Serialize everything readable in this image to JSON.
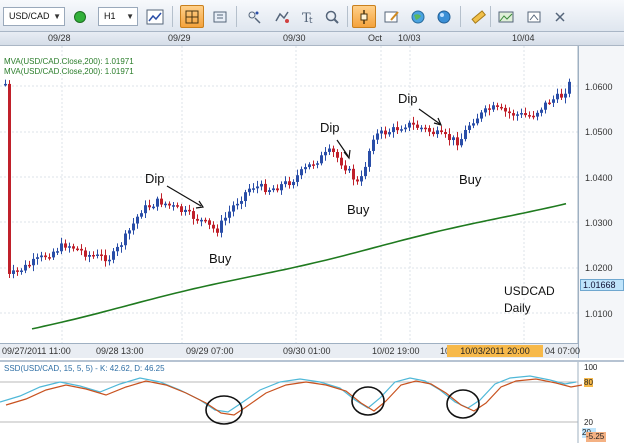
{
  "toolbar": {
    "symbol": "USD/CAD",
    "period": "H1",
    "icons": [
      "status-dot-icon",
      "chart-type-icon",
      "crosshair-icon",
      "zoom-icon",
      "indicator-icon",
      "objects-icon",
      "text-icon",
      "magnify-icon",
      "cursor-icon",
      "pencil-icon",
      "globe-icon",
      "ruler-icon",
      "screenshot-icon",
      "settings-icon",
      "close-icon"
    ]
  },
  "date_header": [
    "09/28",
    "09/29",
    "09/30",
    "Oct",
    "10/03",
    "10/04"
  ],
  "legend": {
    "ma_line1": "MVA(USD/CAD.Close,200): 1.01971",
    "ma_line2": "MVA(USD/CAD.Close,200): 1.01971"
  },
  "annotations": {
    "dip1": "Dip",
    "buy1": "Buy",
    "dip2": "Dip",
    "buy2": "Buy",
    "dip3": "Dip",
    "buy3": "Buy"
  },
  "symbol_text": {
    "line1": "USDCAD",
    "line2": "Daily"
  },
  "price_axis": [
    "1.0600",
    "1.0500",
    "1.0400",
    "1.0300",
    "1.0200",
    "1.0100"
  ],
  "current_price": "1.01668",
  "time_axis": [
    "09/27/2011 11:00",
    "09/28 13:00",
    "09/29 07:00",
    "09/30 01:00",
    "10/02 19:00",
    "10/0",
    "04 07:00"
  ],
  "time_axis_highlight": "10/03/2011 20:00",
  "oscillator": {
    "legend": "SSD(USD/CAD, 15, 5, 5) - K: 42.62, D: 46.25",
    "axis": [
      "100",
      "80",
      "20"
    ],
    "k_tag": "20",
    "d_tag": "-5.25"
  },
  "colors": {
    "bull": "#2a4ea8",
    "bear": "#c0202a",
    "ma": "#1f7a1f",
    "k_line": "#4fb8d8",
    "d_line": "#c8521f",
    "accent_toolbar": "#f4a23c"
  }
}
